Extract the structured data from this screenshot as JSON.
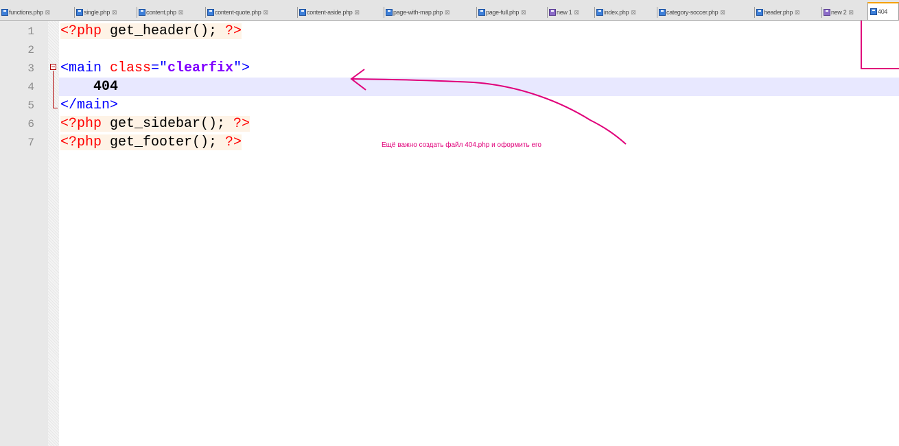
{
  "tabs": [
    {
      "label": "functions.php",
      "modified": false
    },
    {
      "label": "single.php",
      "modified": false
    },
    {
      "label": "content.php",
      "modified": false
    },
    {
      "label": "content-quote.php",
      "modified": false
    },
    {
      "label": "content-aside.php",
      "modified": false
    },
    {
      "label": "page-with-map.php",
      "modified": false
    },
    {
      "label": "page-full.php",
      "modified": false
    },
    {
      "label": "new 1",
      "modified": true
    },
    {
      "label": "index.php",
      "modified": false
    },
    {
      "label": "category-soccer.php",
      "modified": false
    },
    {
      "label": "header.php",
      "modified": false
    },
    {
      "label": "new 2",
      "modified": true
    }
  ],
  "active_tab": {
    "label": "404"
  },
  "line_numbers": [
    "1",
    "2",
    "3",
    "4",
    "5",
    "6",
    "7"
  ],
  "code": {
    "l1": {
      "open": "<?php",
      "fn": " get_header(); ",
      "close": "?>"
    },
    "l3": {
      "tag_open": "<main ",
      "attr": "class",
      "eq": "=\"",
      "str": "clearfix",
      "end": "\">"
    },
    "l4": {
      "text": "404"
    },
    "l5": {
      "tag": "</main>"
    },
    "l6": {
      "open": "<?php",
      "fn": " get_sidebar(); ",
      "close": "?>"
    },
    "l7": {
      "open": "<?php",
      "fn": " get_footer(); ",
      "close": "?>"
    }
  },
  "annotation": {
    "text": "Ещё важно создать файл 404.php и оформить его",
    "color": "#e0007a"
  },
  "colors": {
    "active_tab_accent": "#f4a000",
    "current_line": "#e8e8ff",
    "php_tag": "#ff0000",
    "html_tag": "#0000ff",
    "string": "#8000ff"
  }
}
